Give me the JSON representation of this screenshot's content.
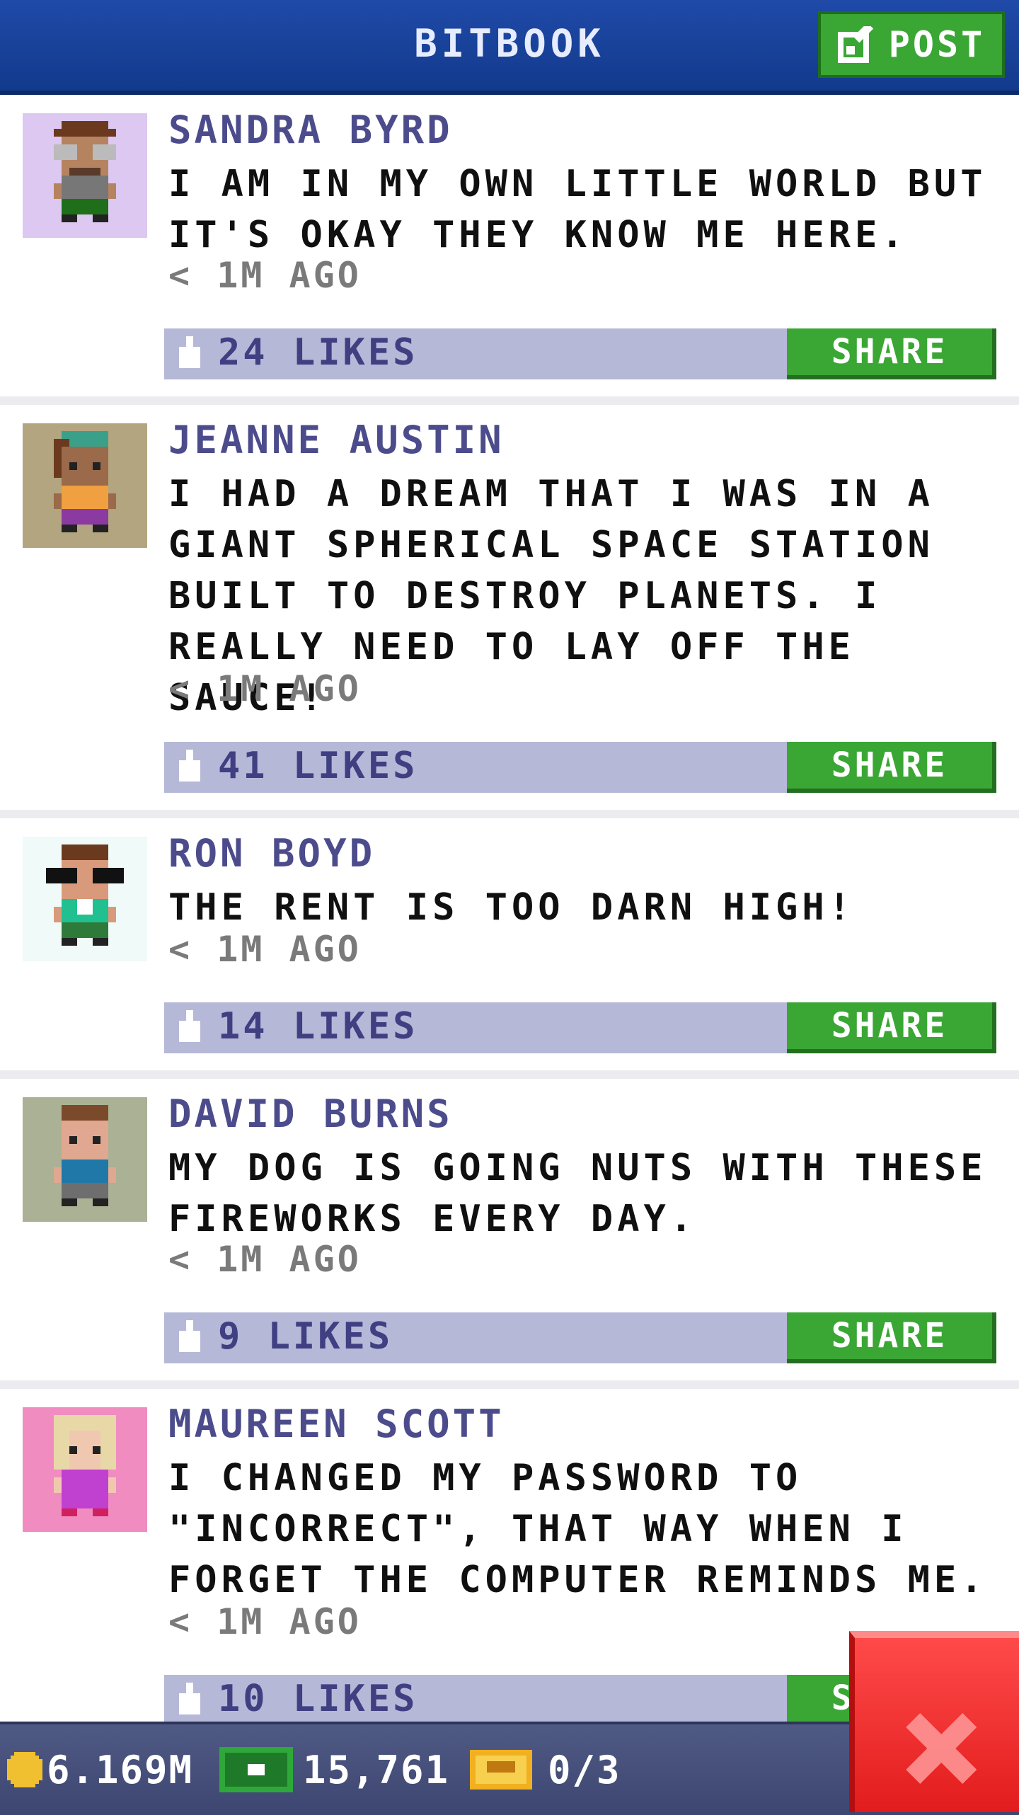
{
  "header": {
    "title": "BITBOOK",
    "post_label": "POST"
  },
  "posts": [
    {
      "name": "SANDRA BYRD",
      "text": "I AM IN MY OWN LITTLE WORLD BUT IT'S OKAY THEY KNOW ME HERE.",
      "time": "< 1M AGO",
      "likes": "24 LIKES",
      "share": "SHARE",
      "avatar_bg": "#dcc8f0"
    },
    {
      "name": "JEANNE AUSTIN",
      "text": "I HAD A DREAM THAT I WAS IN A GIANT SPHERICAL SPACE STATION BUILT TO DESTROY PLANETS. I REALLY NEED TO LAY OFF THE SAUCE!",
      "time": "< 1M AGO",
      "likes": "41 LIKES",
      "share": "SHARE",
      "avatar_bg": "#b3a57f"
    },
    {
      "name": "RON BOYD",
      "text": "THE RENT IS TOO DARN HIGH!",
      "time": "< 1M AGO",
      "likes": "14 LIKES",
      "share": "SHARE",
      "avatar_bg": "#f0faf8"
    },
    {
      "name": "DAVID BURNS",
      "text": "MY DOG IS GOING NUTS WITH THESE FIREWORKS EVERY DAY.",
      "time": "< 1M AGO",
      "likes": "9 LIKES",
      "share": "SHARE",
      "avatar_bg": "#aab195"
    },
    {
      "name": "MAUREEN SCOTT",
      "text": "I CHANGED MY PASSWORD TO \"INCORRECT\", THAT WAY WHEN I FORGET THE COMPUTER REMINDS ME.",
      "time": "< 1M AGO",
      "likes": "10 LIKES",
      "share": "SHARE",
      "avatar_bg": "#f08cc0"
    }
  ],
  "footer": {
    "coins": "6.169M",
    "bux": "15,761",
    "tickets": "0/3"
  },
  "colors": {
    "accent_green": "#3aa634",
    "header_blue": "#1f4aa8",
    "close_red": "#e21c1c"
  }
}
